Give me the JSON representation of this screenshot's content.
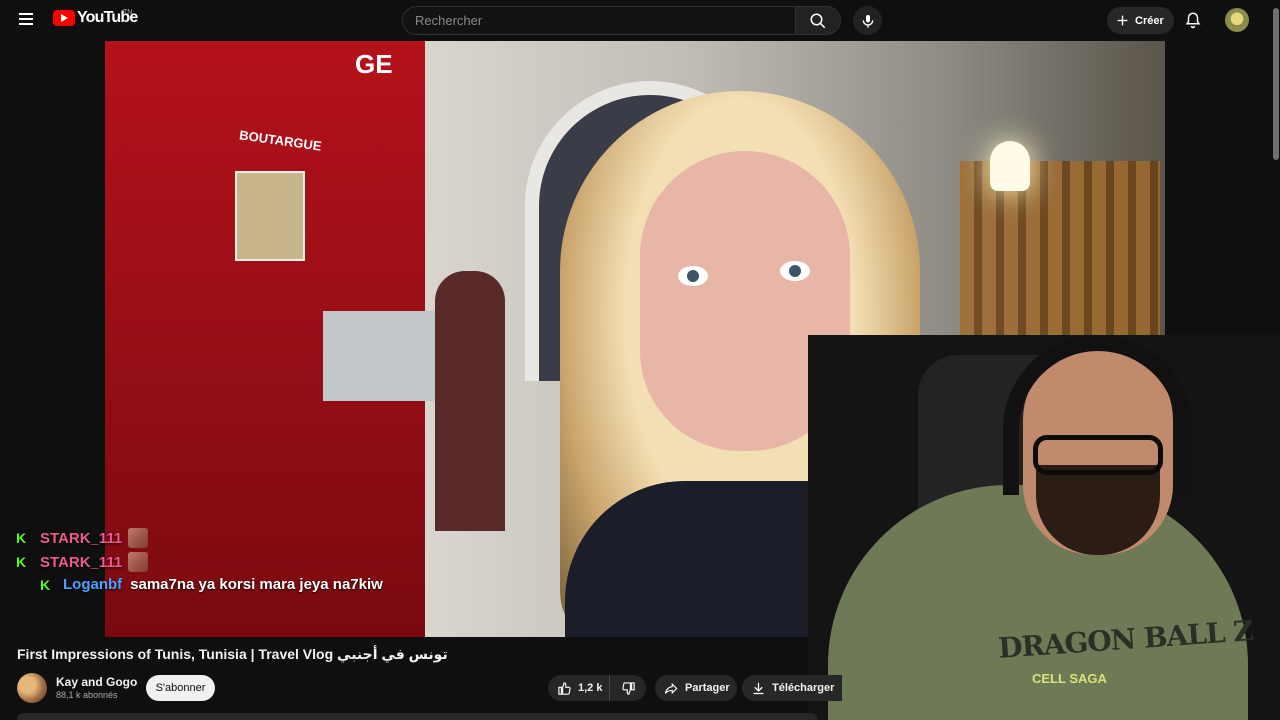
{
  "app": {
    "logo_text": "YouTube",
    "country_code": "TN"
  },
  "search": {
    "placeholder": "Rechercher"
  },
  "header": {
    "create_label": "Créer"
  },
  "video_scene": {
    "sign_top": "GE",
    "sign_label": "BOUTARGUE"
  },
  "chat": {
    "messages": [
      {
        "username": "STARK_111",
        "text": "",
        "color": "#ee5a8f"
      },
      {
        "username": "STARK_111",
        "text": "",
        "color": "#ee5a8f"
      },
      {
        "username": "Loganbf",
        "text": "sama7na ya korsi mara jeya na7kiw",
        "color": "#4aa4ff"
      }
    ]
  },
  "webcam_overlay": {
    "shirt_print": "DRAGON BALL Z",
    "shirt_sub": "CELL SAGA"
  },
  "video": {
    "title": "First Impressions of Tunis, Tunisia | Travel Vlog تونس في أجنبي",
    "channel_name": "Kay and Gogo",
    "subscribers": "88,1 k abonnés",
    "subscribe_label": "S'abonner",
    "likes": "1,2 k",
    "share_label": "Partager",
    "download_label": "Télécharger"
  },
  "colors": {
    "background": "#0f0f0f",
    "brand_red": "#ff0000",
    "kick_green": "#53fc18"
  }
}
